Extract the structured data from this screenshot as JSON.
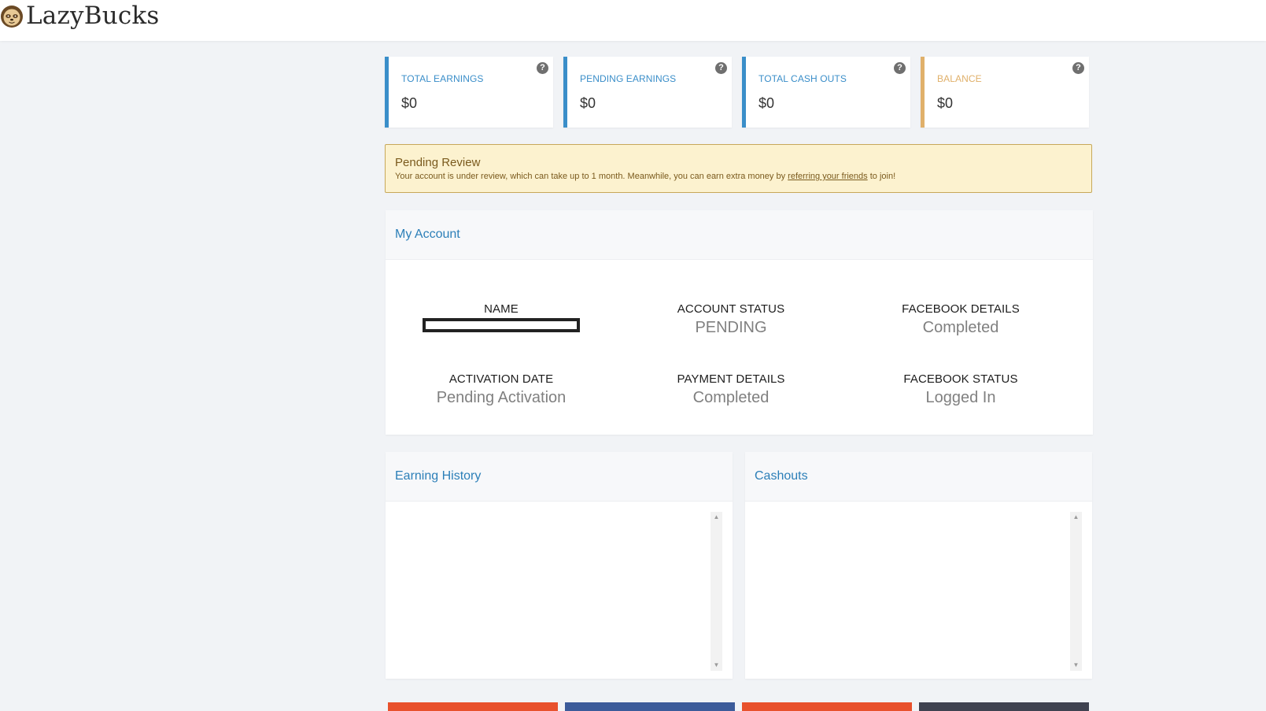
{
  "app": {
    "name": "LazyBucks"
  },
  "stats": [
    {
      "label": "TOTAL EARNINGS",
      "value": "$0",
      "accent": "#3a8ec9",
      "help": "?"
    },
    {
      "label": "PENDING EARNINGS",
      "value": "$0",
      "accent": "#3a8ec9",
      "help": "?"
    },
    {
      "label": "TOTAL CASH OUTS",
      "value": "$0",
      "accent": "#3a8ec9",
      "help": "?"
    },
    {
      "label": "BALANCE",
      "value": "$0",
      "accent": "#e0b06a",
      "help": "?"
    }
  ],
  "alert": {
    "title": "Pending Review",
    "message_before": "Your account is under review, which can take up to 1 month. Meanwhile, you can earn extra money by",
    "link_text": "referring your friends",
    "message_after": "to join!"
  },
  "account": {
    "title": "My Account",
    "fields": [
      {
        "key": "NAME",
        "value": ""
      },
      {
        "key": "ACCOUNT STATUS",
        "value": "PENDING"
      },
      {
        "key": "FACEBOOK DETAILS",
        "value": "Completed"
      },
      {
        "key": "ACTIVATION DATE",
        "value": "Pending Activation"
      },
      {
        "key": "PAYMENT DETAILS",
        "value": "Completed"
      },
      {
        "key": "FACEBOOK STATUS",
        "value": "Logged In"
      }
    ]
  },
  "earning_history": {
    "title": "Earning History"
  },
  "cashouts": {
    "title": "Cashouts"
  },
  "colors": {
    "link_blue": "#2c7fb8",
    "alert_bg": "#fcf2cf",
    "footer_buttons": [
      "#e8512c",
      "#3c5b9a",
      "#e8512c",
      "#3f4250"
    ]
  }
}
